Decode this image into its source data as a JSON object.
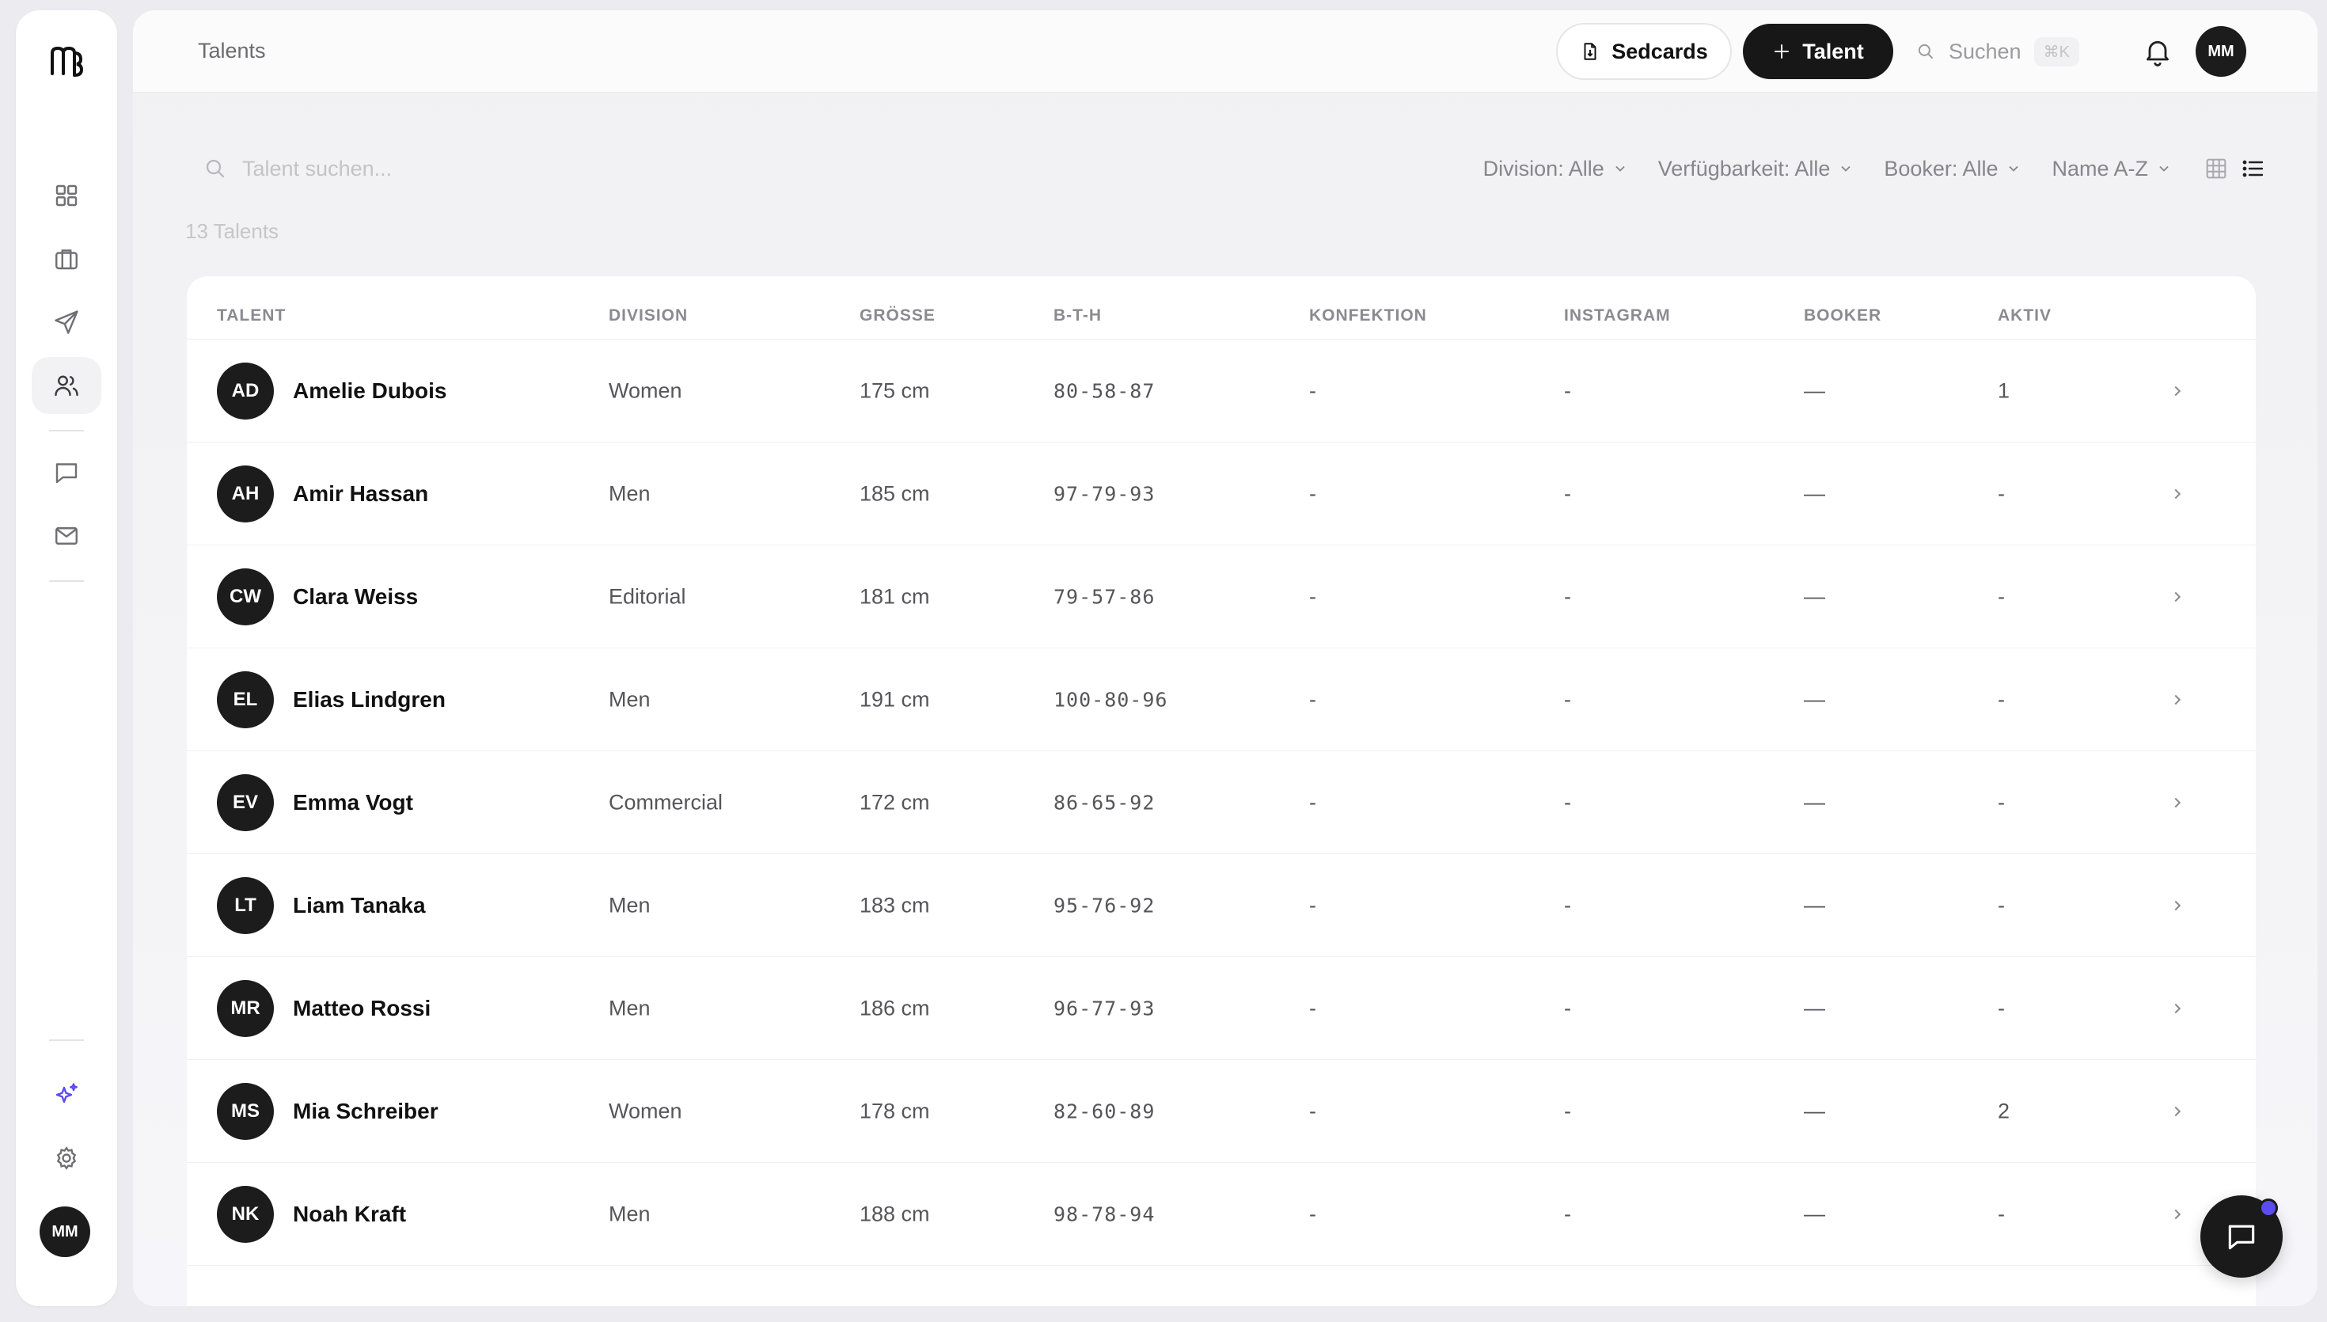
{
  "sidebar": {
    "nav_icons": [
      "dashboard-icon",
      "briefcase-icon",
      "send-icon",
      "users-icon",
      "message-icon",
      "mail-icon",
      "sparkles-icon",
      "settings-icon"
    ],
    "active_item": "users-icon",
    "avatar_initials": "MM"
  },
  "header": {
    "title": "Talents",
    "sedcards_label": "Sedcards",
    "add_talent_label": "Talent",
    "search_label": "Suchen",
    "search_shortcut": "⌘K",
    "avatar_initials": "MM"
  },
  "filters": {
    "search_placeholder": "Talent suchen...",
    "division": "Division: Alle",
    "availability": "Verfügbarkeit: Alle",
    "booker": "Booker: Alle",
    "sort": "Name A-Z",
    "count": "13 Talents"
  },
  "table": {
    "headers": [
      "TALENT",
      "DIVISION",
      "GRÖSSE",
      "B-T-H",
      "KONFEKTION",
      "INSTAGRAM",
      "BOOKER",
      "AKTIV"
    ],
    "rows": [
      {
        "initials": "AD",
        "name": "Amelie Dubois",
        "division": "Women",
        "height": "175 cm",
        "bth": "80-58-87",
        "konfektion": "-",
        "instagram": "-",
        "booker": "—",
        "aktiv": "1"
      },
      {
        "initials": "AH",
        "name": "Amir Hassan",
        "division": "Men",
        "height": "185 cm",
        "bth": "97-79-93",
        "konfektion": "-",
        "instagram": "-",
        "booker": "—",
        "aktiv": "-"
      },
      {
        "initials": "CW",
        "name": "Clara Weiss",
        "division": "Editorial",
        "height": "181 cm",
        "bth": "79-57-86",
        "konfektion": "-",
        "instagram": "-",
        "booker": "—",
        "aktiv": "-"
      },
      {
        "initials": "EL",
        "name": "Elias Lindgren",
        "division": "Men",
        "height": "191 cm",
        "bth": "100-80-96",
        "konfektion": "-",
        "instagram": "-",
        "booker": "—",
        "aktiv": "-"
      },
      {
        "initials": "EV",
        "name": "Emma Vogt",
        "division": "Commercial",
        "height": "172 cm",
        "bth": "86-65-92",
        "konfektion": "-",
        "instagram": "-",
        "booker": "—",
        "aktiv": "-"
      },
      {
        "initials": "LT",
        "name": "Liam Tanaka",
        "division": "Men",
        "height": "183 cm",
        "bth": "95-76-92",
        "konfektion": "-",
        "instagram": "-",
        "booker": "—",
        "aktiv": "-"
      },
      {
        "initials": "MR",
        "name": "Matteo Rossi",
        "division": "Men",
        "height": "186 cm",
        "bth": "96-77-93",
        "konfektion": "-",
        "instagram": "-",
        "booker": "—",
        "aktiv": "-"
      },
      {
        "initials": "MS",
        "name": "Mia Schreiber",
        "division": "Women",
        "height": "178 cm",
        "bth": "82-60-89",
        "konfektion": "-",
        "instagram": "-",
        "booker": "—",
        "aktiv": "2"
      },
      {
        "initials": "NK",
        "name": "Noah Kraft",
        "division": "Men",
        "height": "188 cm",
        "bth": "98-78-94",
        "konfektion": "-",
        "instagram": "-",
        "booker": "—",
        "aktiv": "-"
      }
    ]
  },
  "colors": {
    "accent": "#171717",
    "notification": "#5b4cf0",
    "sparkle": "#5b4cf0"
  }
}
